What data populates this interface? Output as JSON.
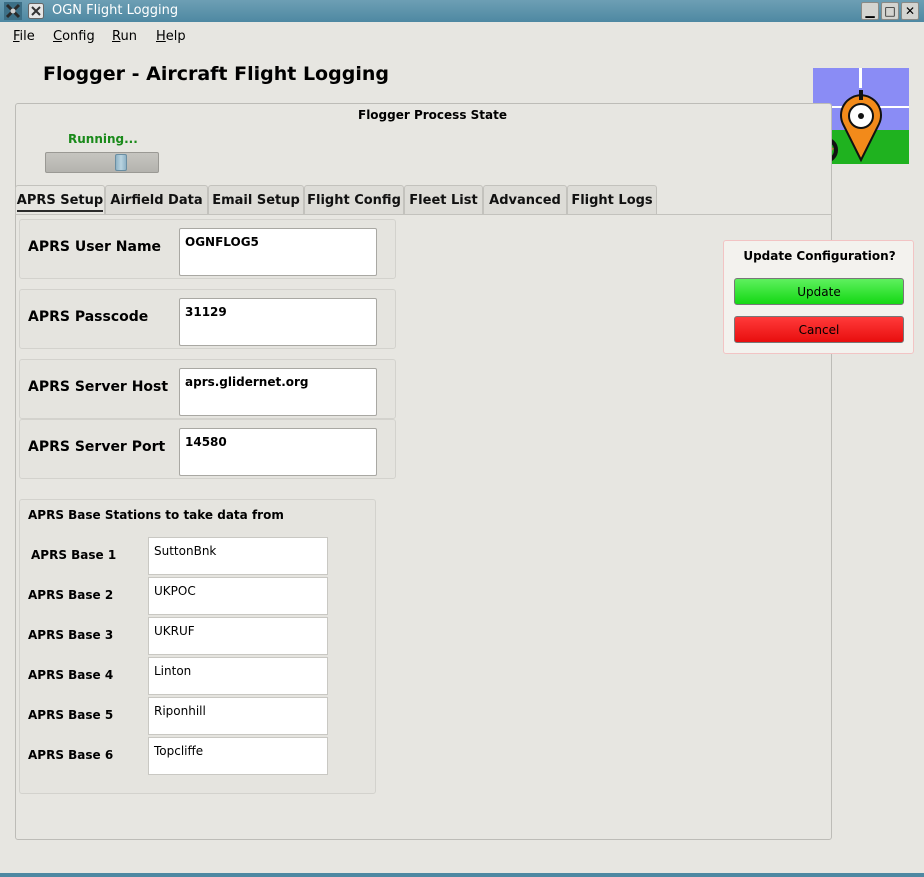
{
  "window": {
    "title": "OGN Flight Logging",
    "controls": {
      "minimize": "▁",
      "maximize": "□",
      "close": "✕"
    }
  },
  "menu": [
    {
      "pre": "",
      "u": "F",
      "post": "ile"
    },
    {
      "pre": "",
      "u": "C",
      "post": "onfig"
    },
    {
      "pre": "",
      "u": "R",
      "post": "un"
    },
    {
      "pre": "",
      "u": "H",
      "post": "elp"
    }
  ],
  "app_title": "Flogger - Aircraft Flight Logging",
  "process": {
    "heading": "Flogger Process State",
    "status": "Running...",
    "status_color": "#1a8a1a"
  },
  "tabs": [
    "APRS Setup",
    "Airfield Data",
    "Email Setup",
    "Flight Config",
    "Fleet List",
    "Advanced",
    "Flight Logs"
  ],
  "active_tab": "APRS Setup",
  "fields": {
    "user_name": {
      "label": "APRS User Name",
      "value": "OGNFLOG5"
    },
    "passcode": {
      "label": "APRS Passcode",
      "value": "31129"
    },
    "server_host": {
      "label": "APRS Server Host",
      "value": "aprs.glidernet.org"
    },
    "server_port": {
      "label": "APRS Server Port",
      "value": "14580"
    }
  },
  "base_stations": {
    "title": "APRS Base Stations to take data from",
    "items": [
      {
        "label": "APRS Base 1",
        "value": "SuttonBnk"
      },
      {
        "label": "APRS Base 2",
        "value": "UKPOC"
      },
      {
        "label": "APRS Base 3",
        "value": "UKRUF"
      },
      {
        "label": "APRS Base 4",
        "value": "Linton"
      },
      {
        "label": "APRS Base 5",
        "value": "Riponhill"
      },
      {
        "label": "APRS Base 6",
        "value": "Topcliffe"
      }
    ]
  },
  "update_dialog": {
    "title": "Update Configuration?",
    "update_label": "Update",
    "cancel_label": "Cancel",
    "update_color": "#22dd22",
    "cancel_color": "#ee1111"
  },
  "colors": {
    "titlebar": "#5a90a9",
    "background": "#e7e6e1"
  },
  "icons": [
    "app-icon",
    "window-menu-icon",
    "logo-image"
  ]
}
